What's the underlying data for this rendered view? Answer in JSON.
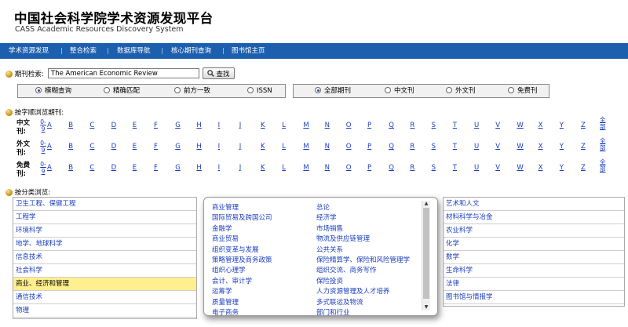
{
  "header": {
    "title_cn": "中国社会科学院学术资源发现平台",
    "title_en": "CASS Academic Resources Discovery System"
  },
  "nav": [
    "学术资源发现",
    "整合检索",
    "数据库导航",
    "核心期刊查询",
    "图书馆主页"
  ],
  "search": {
    "label": "期刊检索:",
    "value": "The American Economic Review",
    "button": "查找",
    "match_options": [
      "模糊查询",
      "精确匹配",
      "前方一致",
      "ISSN"
    ],
    "scope_options": [
      "全部期刊",
      "中文刊",
      "外文刊",
      "免费刊"
    ]
  },
  "alpha": {
    "label": "按字顺浏览期刊:",
    "digit_top": "0-",
    "digit_bottom": "9",
    "letters": [
      "A",
      "B",
      "C",
      "D",
      "E",
      "F",
      "G",
      "H",
      "I",
      "J",
      "K",
      "L",
      "M",
      "N",
      "O",
      "P",
      "Q",
      "R",
      "S",
      "T",
      "U",
      "V",
      "W",
      "X",
      "Y",
      "Z"
    ],
    "all_top": "全",
    "all_bottom": "部",
    "rows": [
      {
        "title_top": "中文",
        "title_bottom": "刊:"
      },
      {
        "title_top": "外文",
        "title_bottom": "刊:"
      },
      {
        "title_top": "免费",
        "title_bottom": "刊:"
      }
    ]
  },
  "categories": {
    "label": "按分类浏览:",
    "left": [
      "卫生工程、保健工程",
      "工程学",
      "环境科学",
      "地学、地球科学",
      "信息技术",
      "社会科学",
      "商业、经济和管理",
      "通信技术",
      "物理"
    ],
    "selected": "商业、经济和管理",
    "right": [
      "艺术和人文",
      "材料科学与冶金",
      "农业科学",
      "化学",
      "数学",
      "生命科学",
      "法律",
      "图书馆与情报学"
    ],
    "popup_col1": [
      "商业管理",
      "国际贸易及跨国公司",
      "金融学",
      "商业贸易",
      "组织变革与发展",
      "策略管理及商务政策",
      "组织心理学",
      "会计、审计学",
      "运筹学",
      "质量管理",
      "电子商务"
    ],
    "popup_col2": [
      "总论",
      "经济学",
      "市场销售",
      "物流及供应链管理",
      "公共关系",
      "保险精算学、保险和风险管理学",
      "组织交流、商务写作",
      "保险投资",
      "人力资源管理及人才培养",
      "多式联运及物流",
      "部门和行业"
    ]
  },
  "colors": {
    "nav_bg": "#1c5fae",
    "link": "#1a3dbf",
    "selected_bg": "#ffef8f"
  },
  "icons": {
    "section_bullet": "gold-ball-icon",
    "search_button": "magnifier-icon"
  }
}
